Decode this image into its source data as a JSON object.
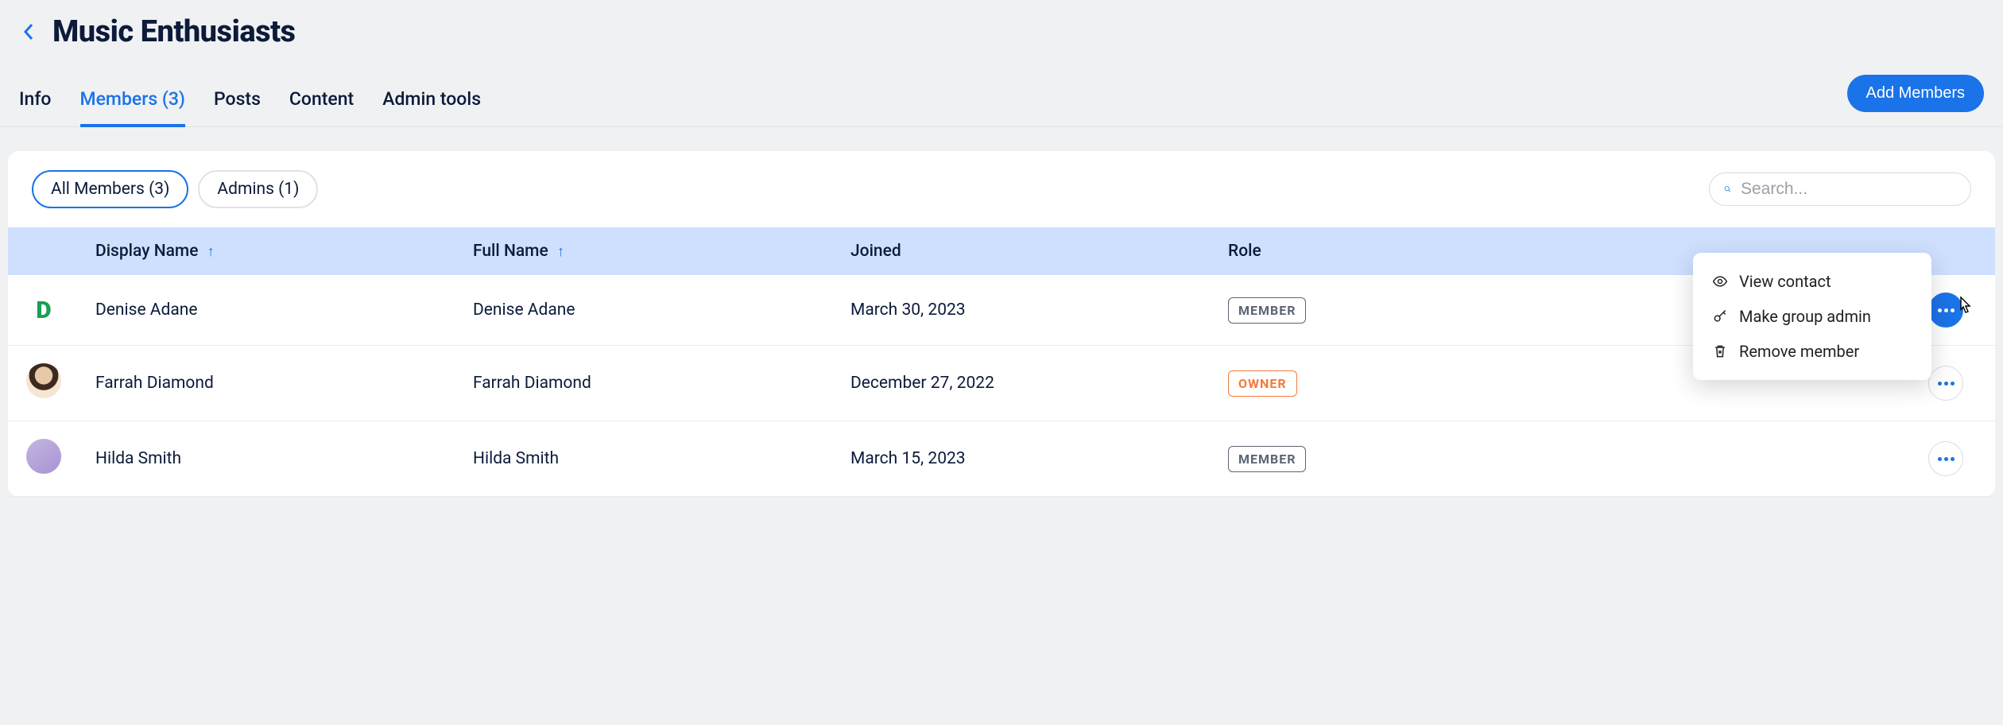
{
  "page_title": "Music Enthusiasts",
  "tabs": {
    "info": "Info",
    "members": "Members (3)",
    "posts": "Posts",
    "content": "Content",
    "admin_tools": "Admin tools"
  },
  "active_tab": "members",
  "add_members_label": "Add Members",
  "filters": {
    "all": "All Members (3)",
    "admins": "Admins (1)"
  },
  "active_filter": "all",
  "search_placeholder": "Search...",
  "columns": {
    "display_name": "Display Name",
    "full_name": "Full Name",
    "joined": "Joined",
    "role": "Role"
  },
  "members": [
    {
      "display_name": "Denise Adane",
      "full_name": "Denise Adane",
      "joined": "March 30, 2023",
      "role": "MEMBER",
      "avatar_type": "letter",
      "avatar_letter": "D"
    },
    {
      "display_name": "Farrah Diamond",
      "full_name": "Farrah Diamond",
      "joined": "December 27, 2022",
      "role": "OWNER",
      "avatar_type": "photo"
    },
    {
      "display_name": "Hilda Smith",
      "full_name": "Hilda Smith",
      "joined": "March 15, 2023",
      "role": "MEMBER",
      "avatar_type": "photo"
    }
  ],
  "context_menu": {
    "view_contact": "View contact",
    "make_admin": "Make group admin",
    "remove_member": "Remove member"
  }
}
